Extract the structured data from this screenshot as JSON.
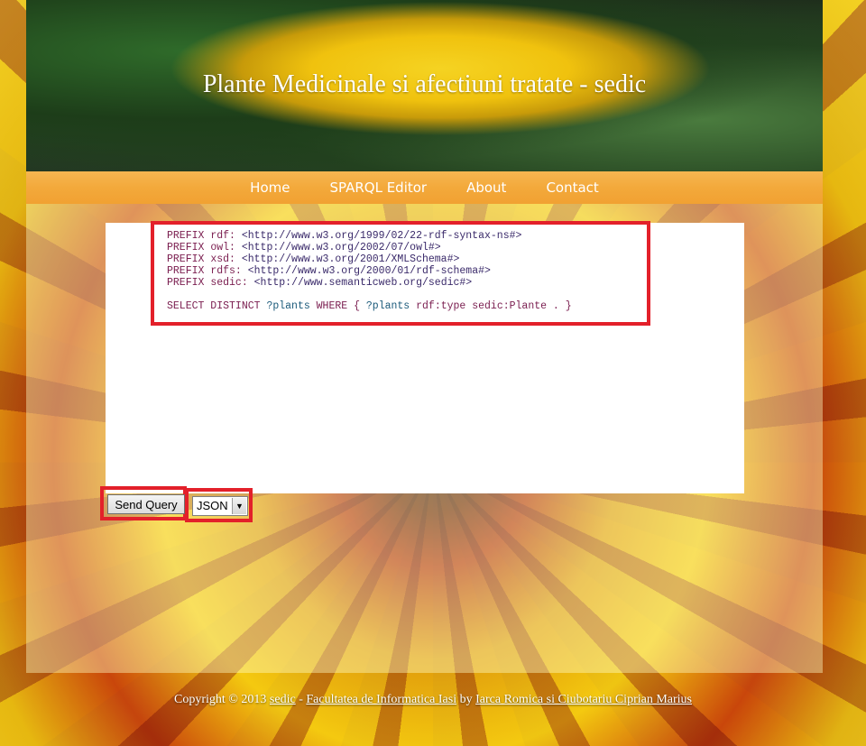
{
  "site": {
    "title": "Plante Medicinale si afectiuni tratate - sedic"
  },
  "nav": {
    "items": [
      "Home",
      "SPARQL Editor",
      "About",
      "Contact"
    ]
  },
  "query": {
    "prefixes": [
      {
        "kw": "PREFIX",
        "name": "rdf:",
        "uri": "<http://www.w3.org/1999/02/22-rdf-syntax-ns#>"
      },
      {
        "kw": "PREFIX",
        "name": "owl:",
        "uri": "<http://www.w3.org/2002/07/owl#>"
      },
      {
        "kw": "PREFIX",
        "name": "xsd:",
        "uri": "<http://www.w3.org/2001/XMLSchema#>"
      },
      {
        "kw": "PREFIX",
        "name": "rdfs:",
        "uri": "<http://www.w3.org/2000/01/rdf-schema#>"
      },
      {
        "kw": "PREFIX",
        "name": "sedic:",
        "uri": "<http://www.semanticweb.org/sedic#>"
      }
    ],
    "select": {
      "kw": "SELECT DISTINCT",
      "var": "?plants",
      "where": "WHERE",
      "body_open": "{",
      "subject": "?plants",
      "predicate": "rdf:type sedic:Plante .",
      "body_close": "}"
    }
  },
  "controls": {
    "send_label": "Send Query",
    "format_value": "JSON",
    "arrow_glyph": "▼"
  },
  "footer": {
    "copyright": "Copyright © 2013",
    "link_sedic": "sedic",
    "sep": "-",
    "link_faculty": "Facultatea de Informatica Iasi",
    "by": "by",
    "link_authors": "Iarca Romica si Ciubotariu Ciprian Marius"
  },
  "colors": {
    "nav_orange": "#f3a93b",
    "highlight_red": "#e3202a",
    "keyword": "#7a1d4f",
    "variable": "#1b5a7a"
  }
}
